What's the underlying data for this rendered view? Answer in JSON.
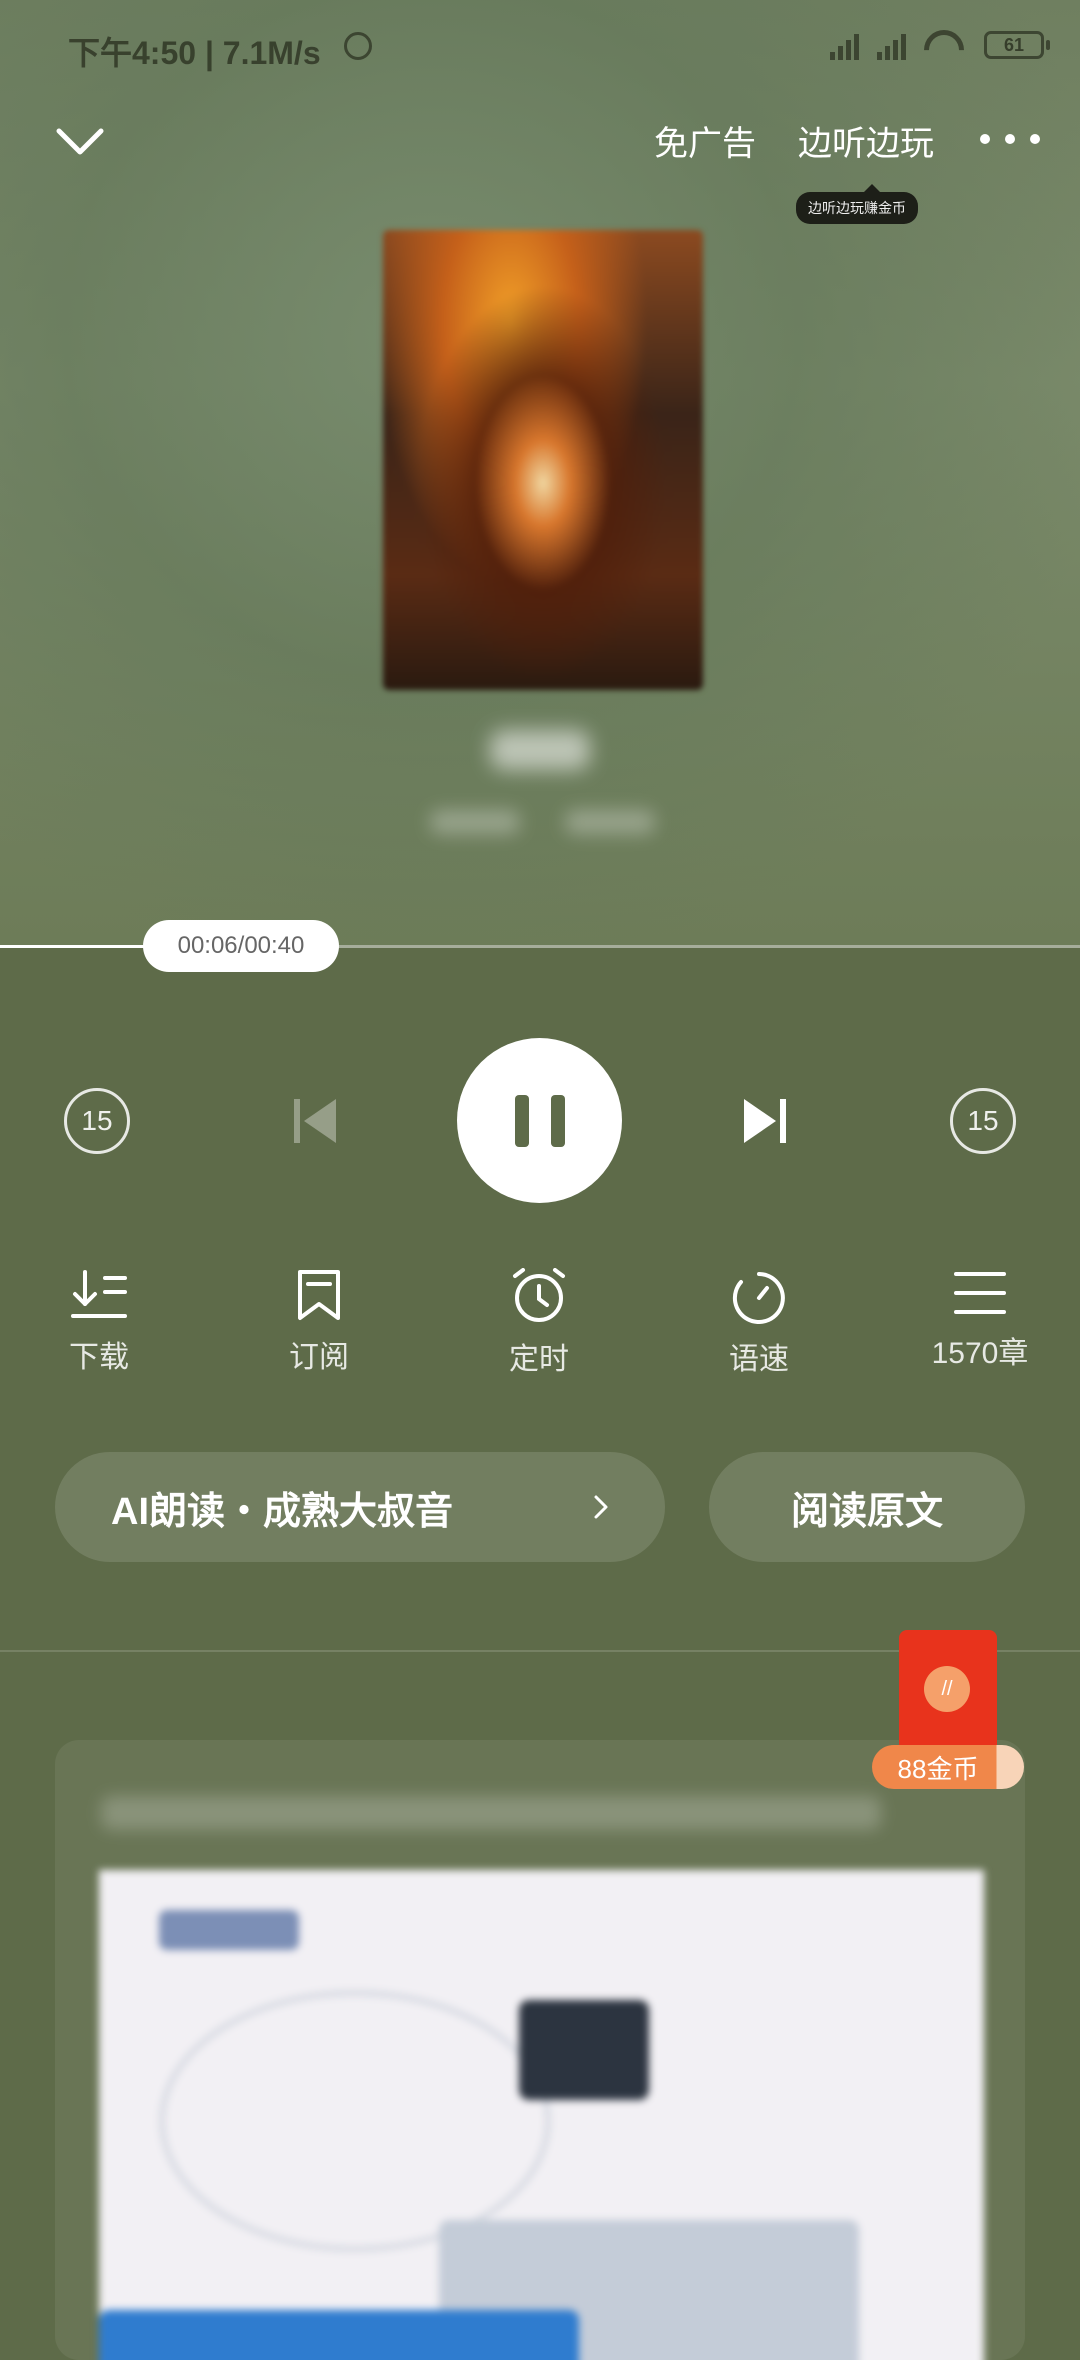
{
  "status_bar": {
    "time_speed": "下午4:50 | 7.1M/s",
    "battery": "61"
  },
  "topbar": {
    "no_ads": "免广告",
    "listen_play": "边听边玩",
    "tooltip": "边听边玩赚金币"
  },
  "player": {
    "time_display": "00:06/00:40",
    "progress": 0.15,
    "rewind_seconds": "15",
    "forward_seconds": "15"
  },
  "tools": {
    "download": "下载",
    "subscribe": "订阅",
    "timer": "定时",
    "speed": "语速",
    "chapters": "1570章"
  },
  "buttons": {
    "ai_voice": "AI朗读・成熟大叔音",
    "read_original": "阅读原文"
  },
  "reward": {
    "coins": "88金币"
  },
  "colors": {
    "background": "#5e6b49",
    "red_packet": "#e8331c",
    "coin_badge": "#f0874a"
  }
}
